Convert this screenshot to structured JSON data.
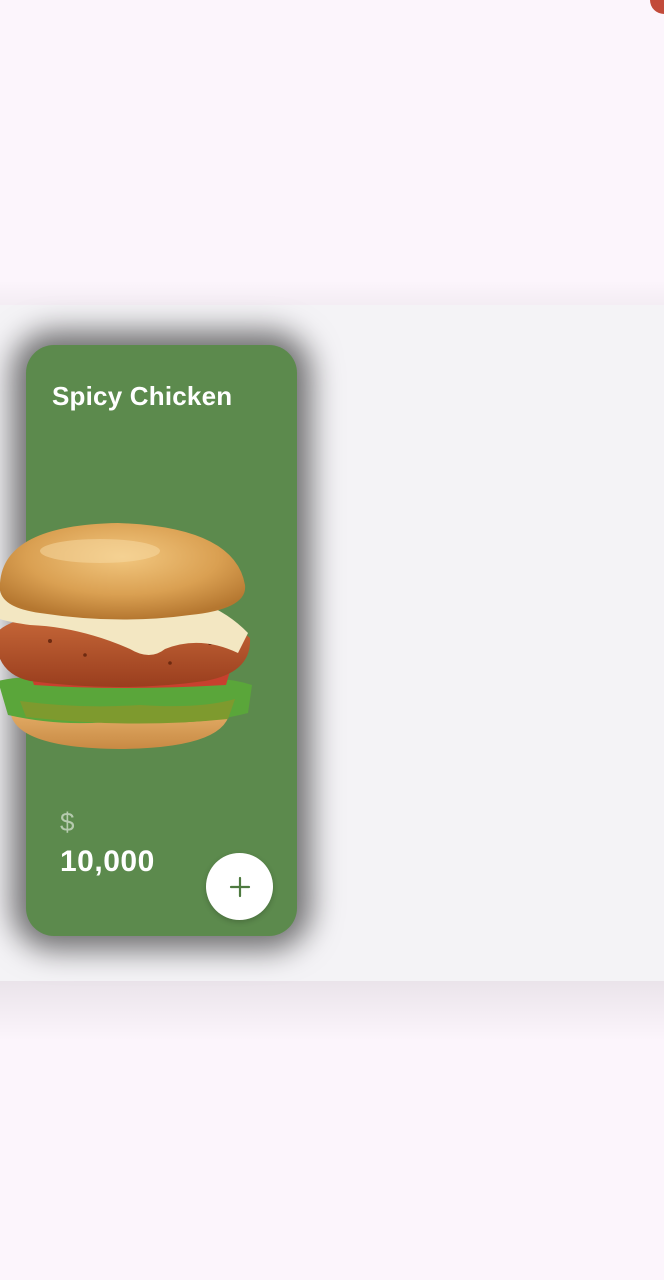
{
  "product": {
    "title": "Spicy Chicken",
    "currency_symbol": "$",
    "price": "10,000",
    "image_icon": "chicken-burger-image",
    "add_icon": "plus-icon"
  },
  "colors": {
    "page_background": "#fcf5fc",
    "carousel_background": "#f4f3f6",
    "card_background": "#5c8a4d",
    "add_button_background": "#ffffff",
    "add_icon": "#4e7a40",
    "corner_accent": "#c24a3a"
  }
}
